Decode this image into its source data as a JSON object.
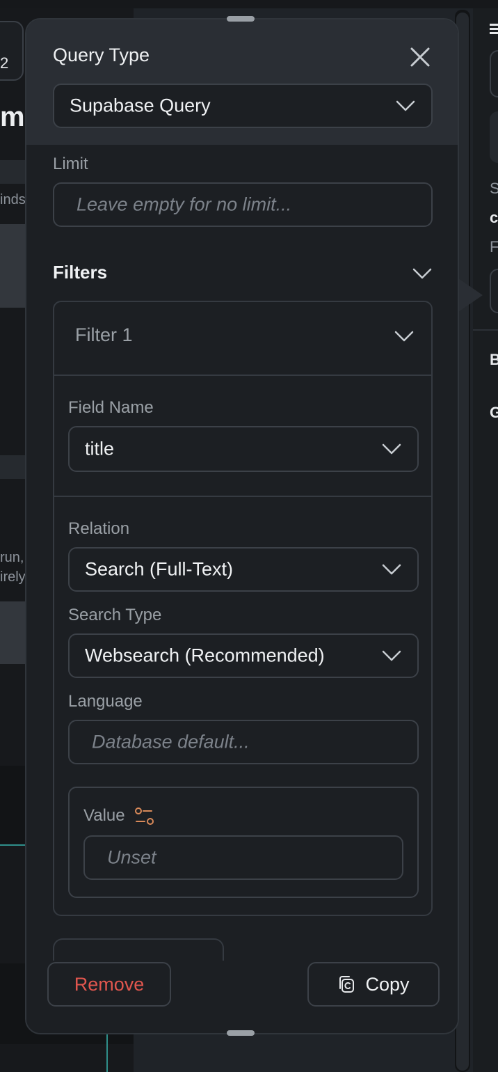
{
  "background": {
    "chip_text": "2",
    "heading_fragment": "m",
    "fragments": [
      "inds",
      "run,",
      "irely"
    ],
    "right_fragments": [
      "S",
      "c",
      "F",
      "B",
      "G"
    ]
  },
  "panel": {
    "title": "Query Type",
    "query_type": {
      "value": "Supabase Query"
    },
    "limit": {
      "label": "Limit",
      "placeholder": "Leave empty for no limit..."
    },
    "filters": {
      "title": "Filters",
      "filter": {
        "title": "Filter 1",
        "field_name": {
          "label": "Field Name",
          "value": "title"
        },
        "relation": {
          "label": "Relation",
          "value": "Search (Full-Text)"
        },
        "search_type": {
          "label": "Search Type",
          "value": "Websearch (Recommended)"
        },
        "language": {
          "label": "Language",
          "placeholder": "Database default..."
        },
        "value": {
          "label": "Value",
          "placeholder": "Unset"
        }
      }
    },
    "footer": {
      "remove_label": "Remove",
      "copy_label": "Copy"
    }
  },
  "colors": {
    "remove": "#e0564e",
    "value_icon": "#d98a5a",
    "teal": "#2f8f8a"
  },
  "icons": [
    "close-icon",
    "chevron-down-icon",
    "variable-toggle-icon",
    "copy-icon",
    "menu-icon"
  ]
}
